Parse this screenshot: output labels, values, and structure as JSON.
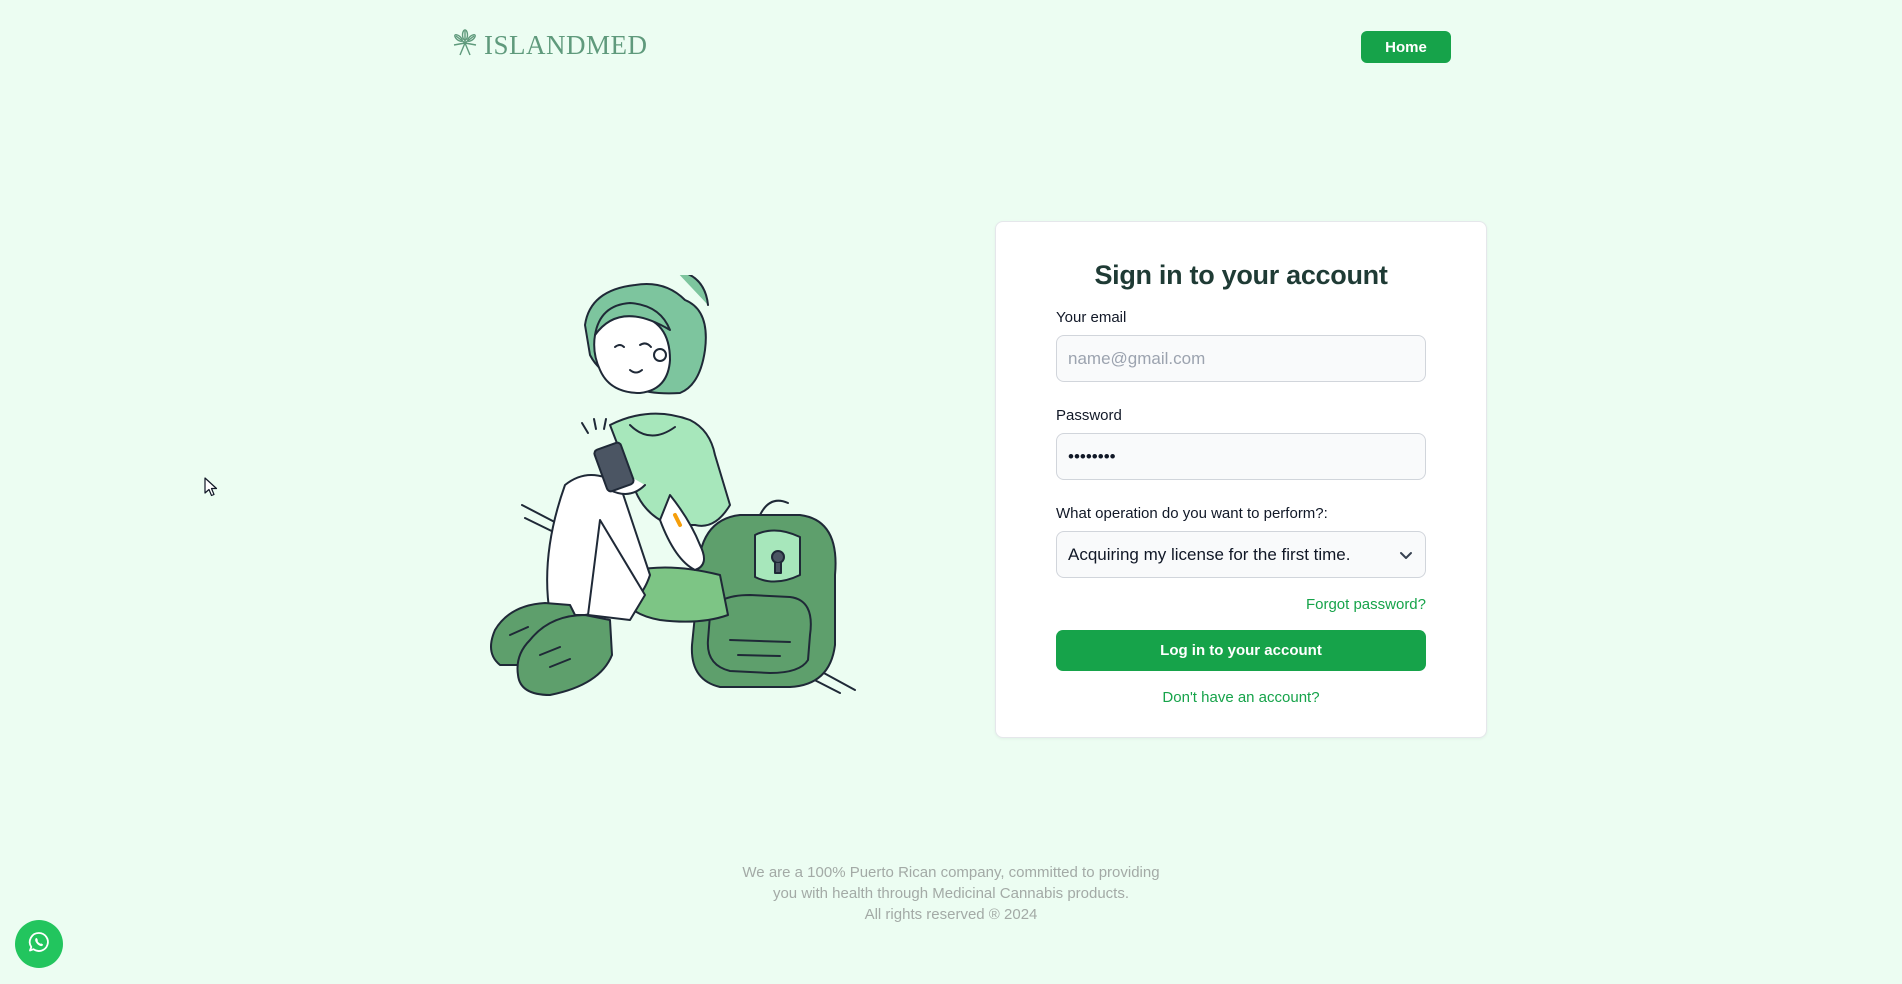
{
  "header": {
    "logo_text": "ISLANDMED",
    "logo_icon": "cannabis-leaf-icon",
    "home_label": "Home"
  },
  "illustration": {
    "description_icon": "person-on-phone-illustration"
  },
  "login": {
    "title": "Sign in to your account",
    "email_label": "Your email",
    "email_placeholder": "name@gmail.com",
    "email_value": "",
    "password_label": "Password",
    "password_value": "••••••••",
    "operation_label": "What operation do you want to perform?:",
    "operation_selected": "Acquiring my license for the first time.",
    "forgot_label": "Forgot password?",
    "login_button_label": "Log in to your account",
    "signup_label": "Don't have an account?"
  },
  "footer": {
    "line1": "We are a 100% Puerto Rican company, committed to providing",
    "line2": "you with health through Medicinal Cannabis products.",
    "line3": "All rights reserved ® 2024"
  },
  "colors": {
    "background": "#ecfdf2",
    "accent": "#16a34a",
    "whatsapp": "#22c55e"
  }
}
